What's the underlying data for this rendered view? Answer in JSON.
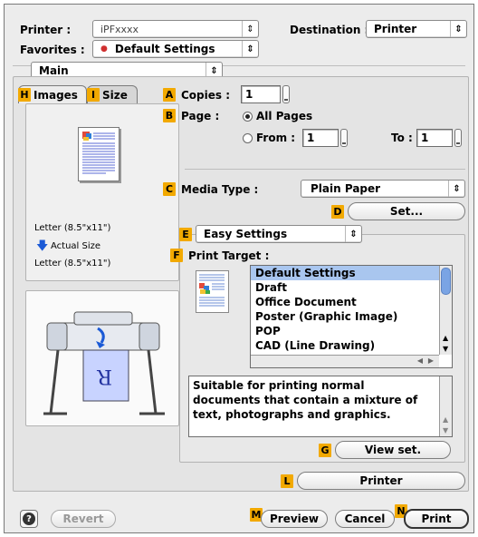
{
  "printer": {
    "label": "Printer :",
    "value": "iPFxxxx"
  },
  "destination": {
    "label": "Destination :",
    "value": "Printer"
  },
  "favorites": {
    "label": "Favorites :",
    "value": "Default Settings"
  },
  "panel": {
    "value": "Main"
  },
  "tabs": [
    {
      "badge": "H",
      "label": "Images"
    },
    {
      "badge": "I",
      "label": "Size"
    }
  ],
  "preview_info": {
    "paper1": "Letter (8.5\"x11\")",
    "scale": "Actual Size",
    "paper2": "Letter (8.5\"x11\")"
  },
  "copies": {
    "badge": "A",
    "label": "Copies :",
    "value": "1"
  },
  "page": {
    "badge": "B",
    "label": "Page :",
    "all_pages": "All Pages",
    "from_label": "From :",
    "from_value": "1",
    "to_label": "To :",
    "to_value": "1"
  },
  "media_type": {
    "badge": "C",
    "label": "Media Type :",
    "value": "Plain Paper"
  },
  "set_button": {
    "badge": "D",
    "label": "Set..."
  },
  "settings_mode": {
    "badge": "E",
    "value": "Easy Settings"
  },
  "print_target": {
    "badge": "F",
    "label": "Print Target :",
    "items": [
      "Default Settings",
      "Draft",
      "Office Document",
      "Poster (Graphic Image)",
      "POP",
      "CAD (Line Drawing)"
    ],
    "selected_index": 0,
    "description": "Suitable for printing normal documents that contain a mixture of text, photographs and graphics."
  },
  "view_set": {
    "badge": "G",
    "label": "View set."
  },
  "printer_button": {
    "badge": "L",
    "label": "Printer"
  },
  "footer": {
    "help": "?",
    "revert": "Revert",
    "preview": {
      "badge": "M",
      "label": "Preview"
    },
    "cancel": "Cancel",
    "print": {
      "badge": "N",
      "label": "Print"
    }
  },
  "colors": {
    "badge": "#f2a900",
    "selection": "#a9c6ef",
    "scroll": "#7aa4e4"
  }
}
